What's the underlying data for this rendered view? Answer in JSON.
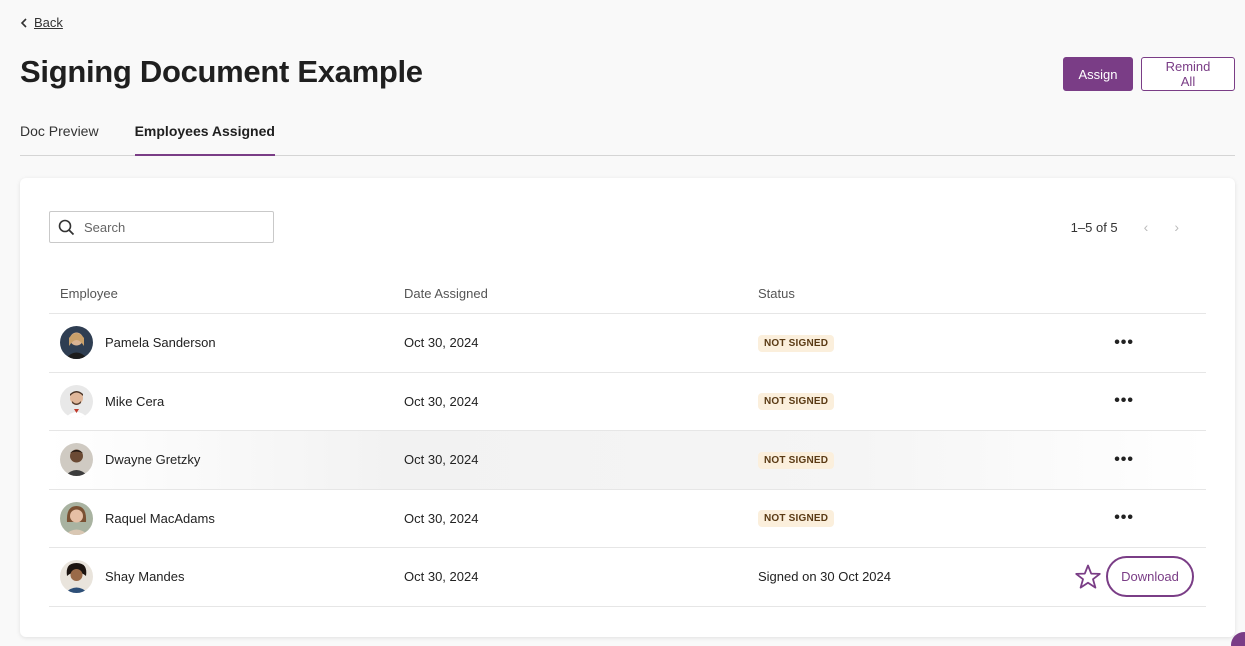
{
  "nav": {
    "back_label": "Back"
  },
  "page": {
    "title": "Signing Document Example"
  },
  "actions": {
    "assign_label": "Assign",
    "remind_all_label": "Remind All"
  },
  "tabs": [
    {
      "label": "Doc Preview",
      "active": false
    },
    {
      "label": "Employees Assigned",
      "active": true
    }
  ],
  "search": {
    "placeholder": "Search",
    "value": ""
  },
  "pagination": {
    "range_label": "1–5 of 5",
    "prev_icon": "chevron-left-icon",
    "next_icon": "chevron-right-icon"
  },
  "table": {
    "headers": {
      "employee": "Employee",
      "date": "Date Assigned",
      "status": "Status"
    },
    "rows": [
      {
        "name": "Pamela Sanderson",
        "date": "Oct 30, 2024",
        "status": "NOT SIGNED",
        "action": "more"
      },
      {
        "name": "Mike Cera",
        "date": "Oct 30, 2024",
        "status": "NOT SIGNED",
        "action": "more"
      },
      {
        "name": "Dwayne Gretzky",
        "date": "Oct 30, 2024",
        "status": "NOT SIGNED",
        "action": "more"
      },
      {
        "name": "Raquel MacAdams",
        "date": "Oct 30, 2024",
        "status": "NOT SIGNED",
        "action": "more"
      },
      {
        "name": "Shay Mandes",
        "date": "Oct 30, 2024",
        "status": "Signed on 30 Oct 2024",
        "action": "download"
      }
    ],
    "more_label": "•••",
    "download_label": "Download"
  },
  "colors": {
    "accent": "#7a3d86",
    "badge_bg": "#fbefdc",
    "badge_text": "#5a3a14"
  }
}
